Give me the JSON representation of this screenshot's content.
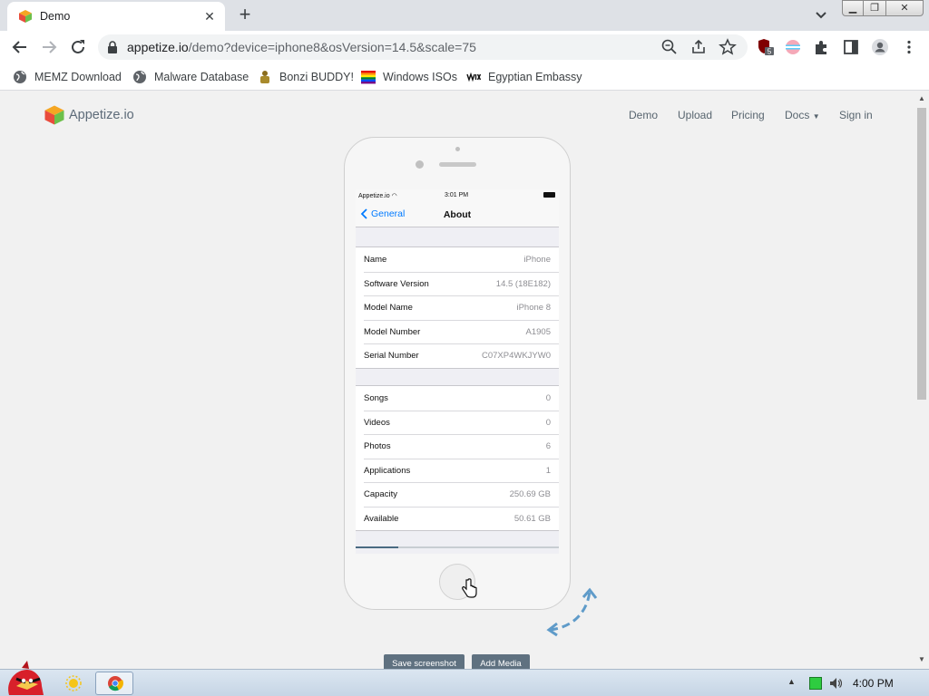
{
  "browser": {
    "tab_title": "Demo",
    "url_host": "appetize.io",
    "url_path": "/demo?device=iphone8&osVersion=14.5&scale=75",
    "extension_badge": "5"
  },
  "bookmarks": [
    {
      "label": "MEMZ Download",
      "icon": "globe-icon"
    },
    {
      "label": "Malware Database",
      "icon": "globe-icon"
    },
    {
      "label": "Bonzi BUDDY!",
      "icon": "bonzi-icon"
    },
    {
      "label": "Windows ISOs",
      "icon": "windows-flag-icon"
    },
    {
      "label": "Egyptian Embassy",
      "icon": "wix-icon"
    }
  ],
  "site": {
    "logo_text": "Appetize.io",
    "nav": {
      "demo": "Demo",
      "upload": "Upload",
      "pricing": "Pricing",
      "docs": "Docs",
      "signin": "Sign in"
    }
  },
  "device": {
    "status": {
      "carrier": "Appetize.io",
      "time": "3:01 PM"
    },
    "nav": {
      "back_label": "General",
      "title": "About"
    },
    "group1": [
      {
        "label": "Name",
        "value": "iPhone"
      },
      {
        "label": "Software Version",
        "value": "14.5 (18E182)"
      },
      {
        "label": "Model Name",
        "value": "iPhone 8"
      },
      {
        "label": "Model Number",
        "value": "A1905"
      },
      {
        "label": "Serial Number",
        "value": "C07XP4WKJYW0"
      }
    ],
    "group2": [
      {
        "label": "Songs",
        "value": "0"
      },
      {
        "label": "Videos",
        "value": "0"
      },
      {
        "label": "Photos",
        "value": "6"
      },
      {
        "label": "Applications",
        "value": "1"
      },
      {
        "label": "Capacity",
        "value": "250.69 GB"
      },
      {
        "label": "Available",
        "value": "50.61 GB"
      }
    ],
    "loading_progress": 0.21
  },
  "actions": {
    "save_screenshot": "Save screenshot",
    "add_media": "Add Media"
  },
  "taskbar": {
    "clock": "4:00 PM"
  },
  "colors": {
    "accent": "#007aff",
    "button": "#5f7180",
    "progress": "#4a6a82"
  }
}
